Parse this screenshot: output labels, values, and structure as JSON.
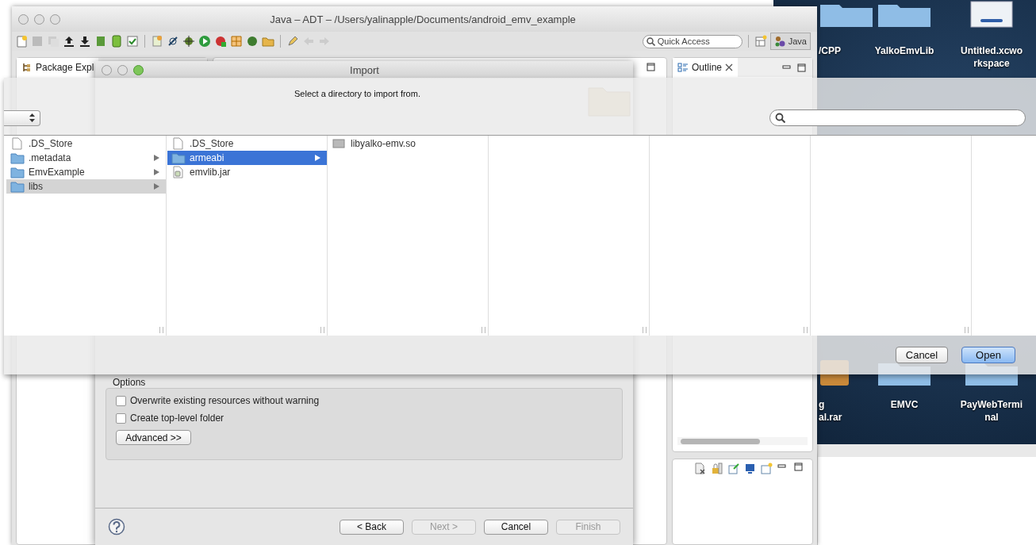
{
  "desktop": {
    "icons": [
      {
        "label": "/CPP",
        "kind": "folder"
      },
      {
        "label": "YalkoEmvLib",
        "kind": "folder"
      },
      {
        "label": "Untitled.xcworkspace",
        "kind": "workspace"
      },
      {
        "label": "g al.rar",
        "kind": "archive"
      },
      {
        "label": "EMVC",
        "kind": "folder"
      },
      {
        "label": "PayWebTerminal",
        "kind": "folder"
      }
    ]
  },
  "ide_window": {
    "title": "Java – ADT – /Users/yalinapple/Documents/android_emv_example",
    "quick_access": {
      "placeholder": "Quick Access"
    },
    "perspective": "Java",
    "tabs": [
      {
        "label": "Package Expl",
        "kind": "package"
      },
      {
        "label": "Outline",
        "kind": "outline"
      }
    ]
  },
  "import_dialog": {
    "title": "Import",
    "options_title": "Options",
    "options": [
      {
        "label": "Overwrite existing resources without warning",
        "checked": false
      },
      {
        "label": "Create top-level folder",
        "checked": false
      }
    ],
    "advanced": "Advanced >>",
    "buttons": [
      {
        "label": "< Back",
        "disabled": false
      },
      {
        "label": "Next >",
        "disabled": true
      },
      {
        "label": "Cancel",
        "disabled": false
      },
      {
        "label": "Finish",
        "disabled": true
      }
    ]
  },
  "open_sheet": {
    "prompt": "Select a directory to import from.",
    "columns": [
      {
        "active": false,
        "items": [
          {
            "name": ".DS_Store",
            "kind": "file",
            "selected": false
          },
          {
            "name": ".metadata",
            "kind": "folder",
            "selected": false
          },
          {
            "name": "EmvExample",
            "kind": "folder",
            "selected": false
          },
          {
            "name": "libs",
            "kind": "folder",
            "selected": true
          }
        ]
      },
      {
        "active": true,
        "items": [
          {
            "name": ".DS_Store",
            "kind": "file",
            "selected": false
          },
          {
            "name": "armeabi",
            "kind": "folder",
            "selected": true
          },
          {
            "name": "emvlib.jar",
            "kind": "jar",
            "selected": false
          }
        ]
      },
      {
        "items": [
          {
            "name": "libyalko-emv.so",
            "kind": "library",
            "selected": false
          }
        ]
      }
    ],
    "buttons": [
      {
        "label": "Cancel",
        "default": false
      },
      {
        "label": "Open",
        "default": true
      }
    ]
  }
}
